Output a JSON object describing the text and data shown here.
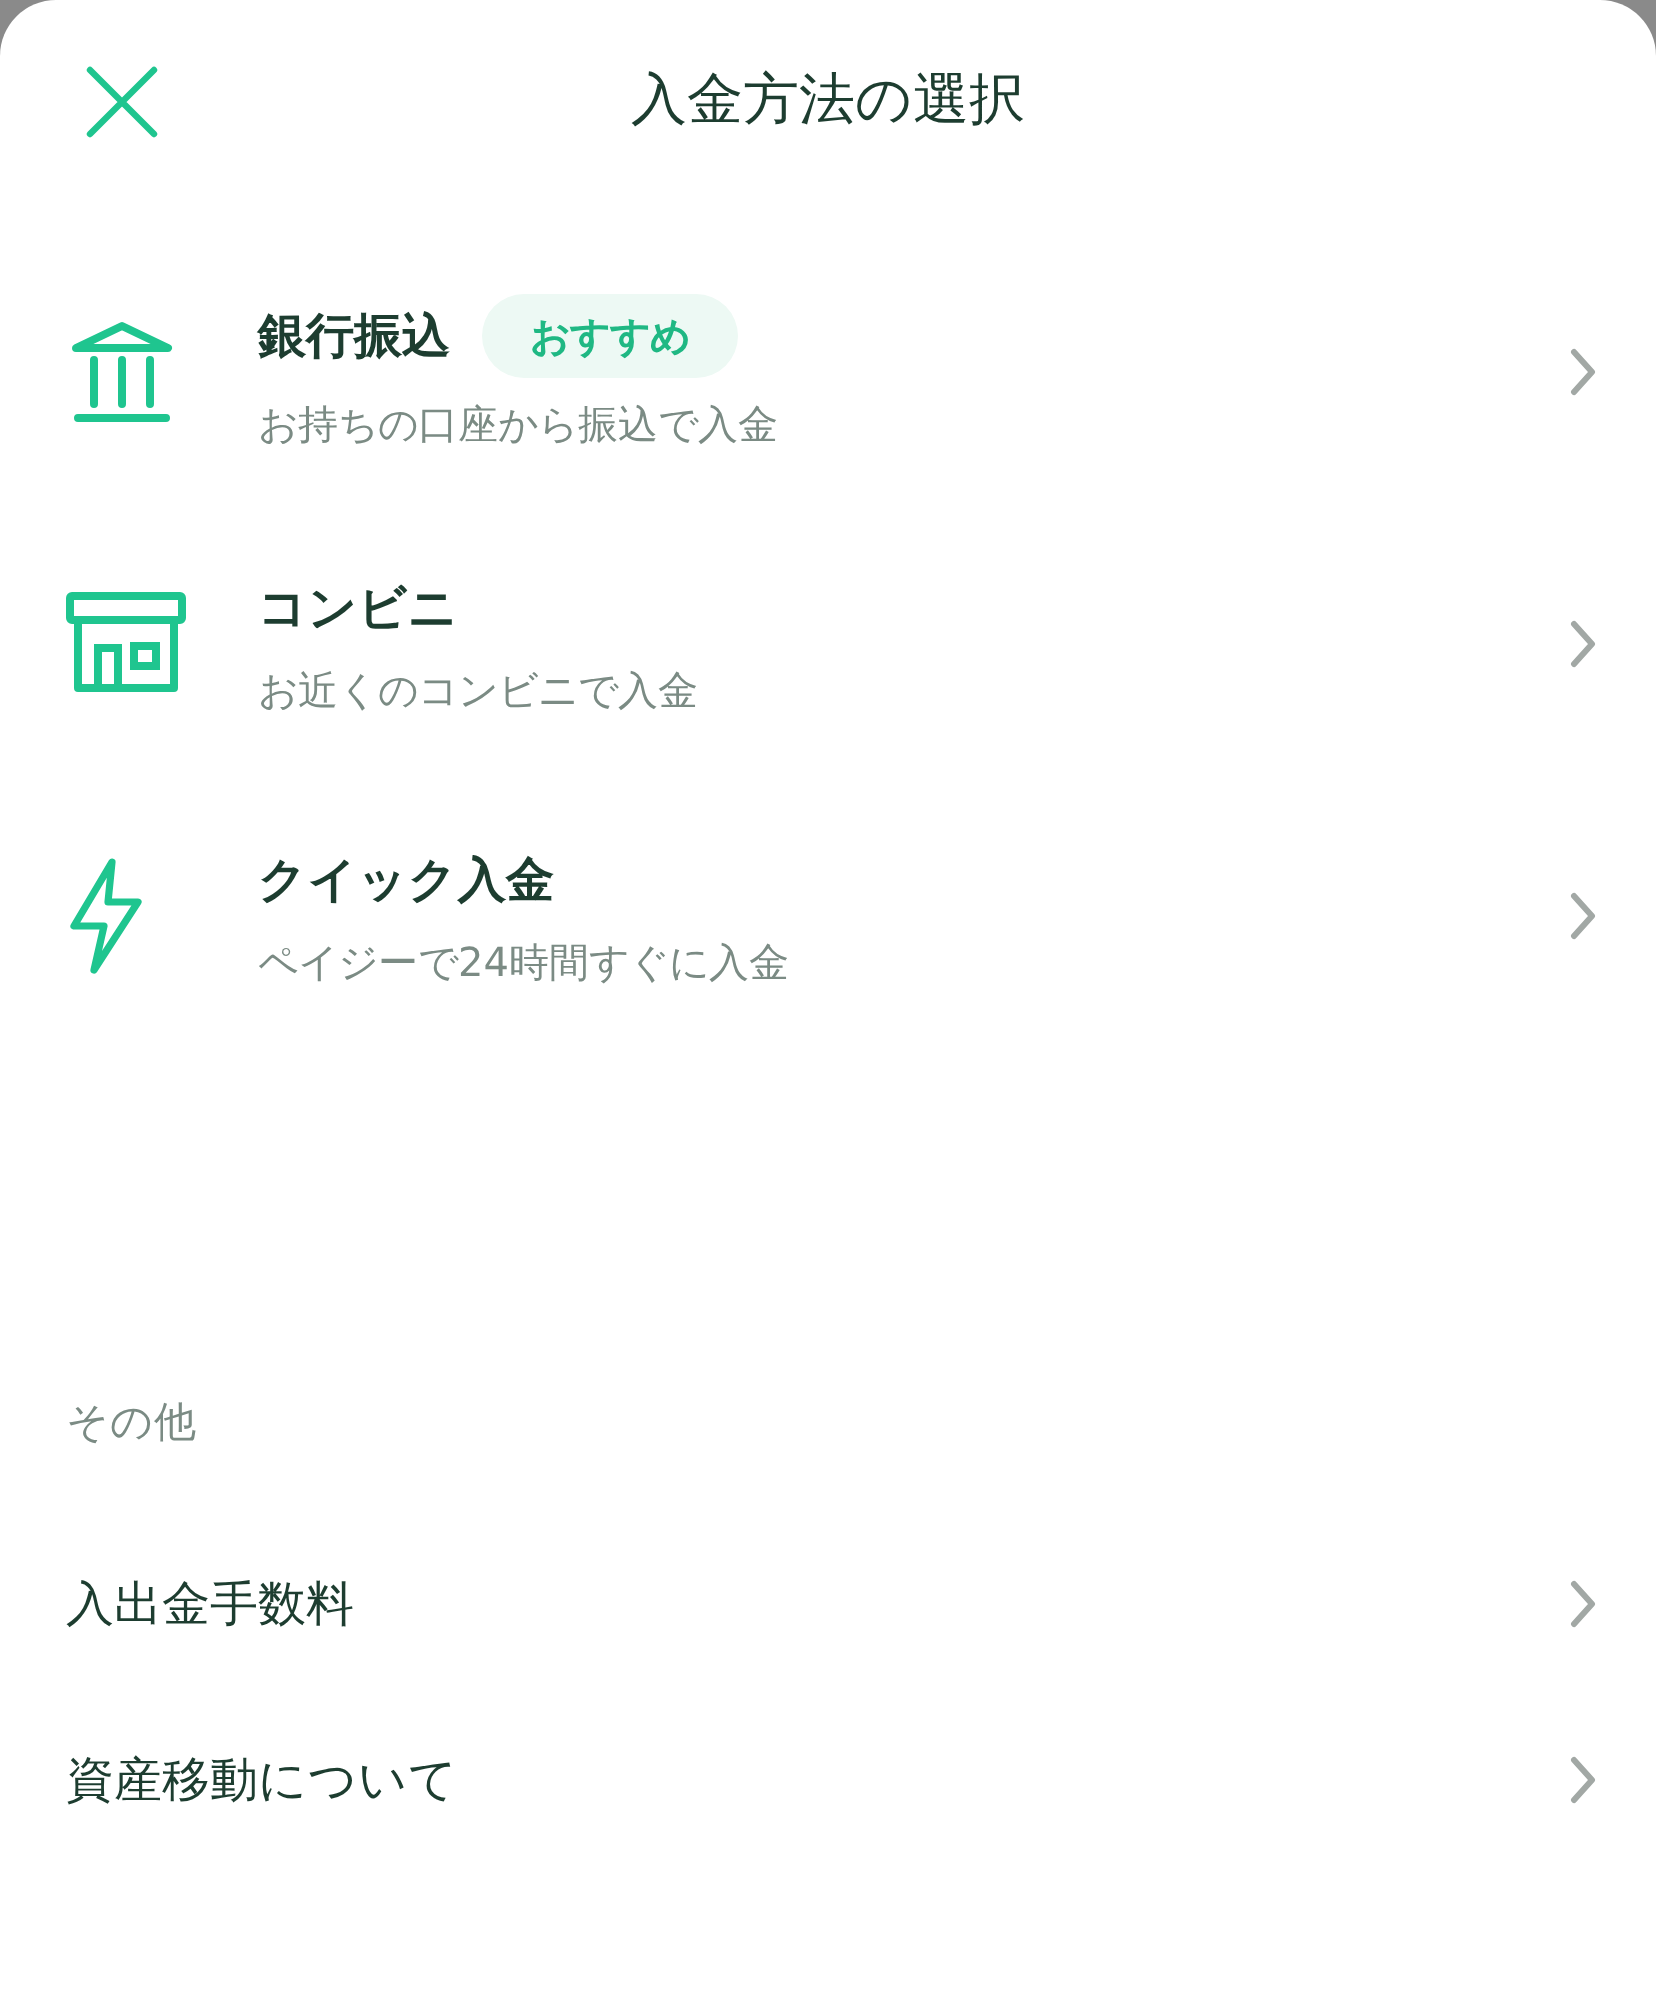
{
  "header": {
    "title": "入金方法の選択"
  },
  "methods": [
    {
      "kind": "bank",
      "title": "銀行振込",
      "badge": "おすすめ",
      "subtitle": "お持ちの口座から振込で入金"
    },
    {
      "kind": "store",
      "title": "コンビニ",
      "subtitle": "お近くのコンビニで入金"
    },
    {
      "kind": "quick",
      "title": "クイック入金",
      "subtitle": "ペイジーで24時間すぐに入金"
    }
  ],
  "other": {
    "heading": "その他",
    "items": [
      "入出金手数料",
      "資産移動について"
    ]
  }
}
